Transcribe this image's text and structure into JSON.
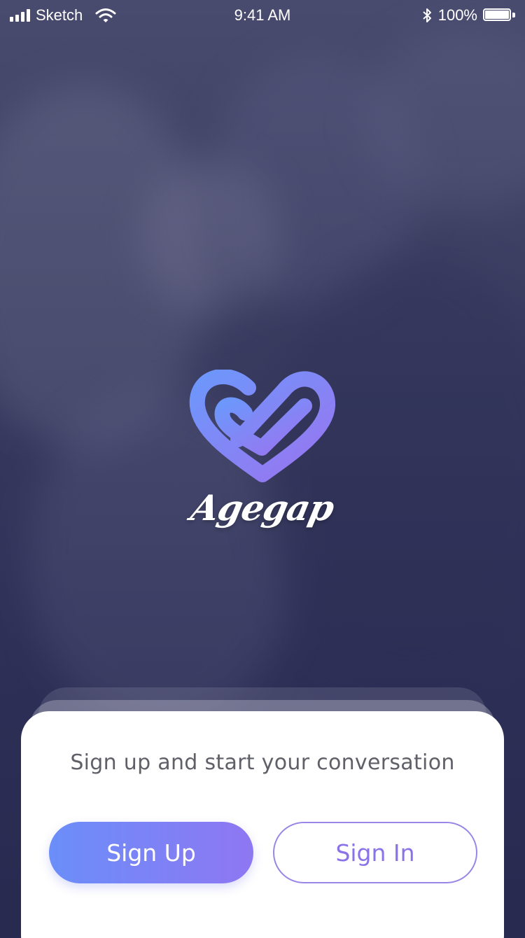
{
  "status_bar": {
    "carrier": "Sketch",
    "time": "9:41 AM",
    "battery": "100%"
  },
  "brand": {
    "name": "Agegap"
  },
  "card": {
    "title": "Sign up and start your conversation",
    "sign_up_label": "Sign Up",
    "sign_in_label": "Sign In"
  },
  "colors": {
    "accent_start": "#6b8ef9",
    "accent_end": "#8e77f2",
    "outline": "#9a86e6",
    "background": "#3c3f61"
  },
  "icons": [
    "signal-icon",
    "wifi-icon",
    "bluetooth-icon",
    "battery-icon",
    "heart-logo-icon"
  ]
}
